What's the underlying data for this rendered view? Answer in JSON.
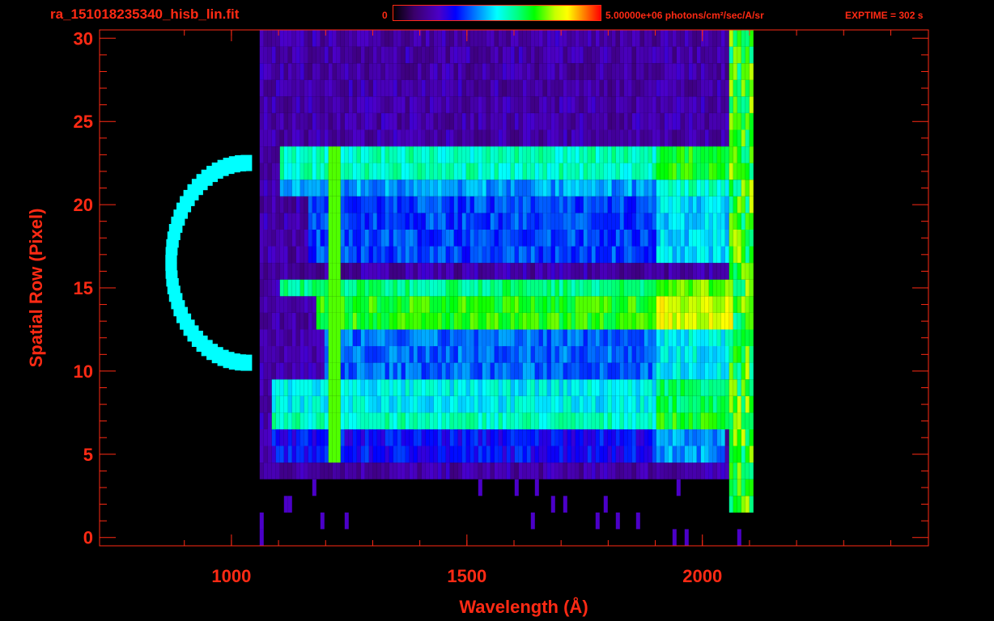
{
  "header": {
    "file_title": "ra_151018235340_hisb_lin.fit",
    "colorbar_min": "0",
    "colorbar_max": "5.00000e+06 photons/cm²/sec/A/sr",
    "exptime": "EXPTIME = 302 s"
  },
  "colors": {
    "foreground": "#ff2a14",
    "background": "#000000"
  },
  "chart_data": {
    "type": "heatmap",
    "xlabel": "Wavelength (Å)",
    "ylabel": "Spatial Row (Pixel)",
    "xlim": [
      720,
      2480
    ],
    "ylim": [
      -0.5,
      30.5
    ],
    "x_ticks": [
      1000,
      1500,
      2000
    ],
    "y_ticks": [
      0,
      5,
      10,
      15,
      20,
      25,
      30
    ],
    "colorbar_range": [
      0,
      5000000
    ],
    "detector_range_angstrom": [
      1060,
      2100
    ],
    "bands": [
      {
        "rows": [
          22,
          23
        ],
        "x_start": 1100,
        "x_end": 2060,
        "level": 0.55
      },
      {
        "rows": [
          21
        ],
        "x_start": 1100,
        "x_end": 2060,
        "level": 0.42
      },
      {
        "rows": [
          17,
          18,
          19,
          20
        ],
        "x_start": 1160,
        "x_end": 2060,
        "level": 0.35
      },
      {
        "rows": [
          15
        ],
        "x_start": 1100,
        "x_end": 2060,
        "level": 0.6
      },
      {
        "rows": [
          14,
          13
        ],
        "x_start": 1180,
        "x_end": 2060,
        "level": 0.68
      },
      {
        "rows": [
          12,
          11,
          10
        ],
        "x_start": 1190,
        "x_end": 2060,
        "level": 0.38
      },
      {
        "rows": [
          9,
          8
        ],
        "x_start": 1080,
        "x_end": 2060,
        "level": 0.5
      },
      {
        "rows": [
          7
        ],
        "x_start": 1080,
        "x_end": 2060,
        "level": 0.55
      },
      {
        "rows": [
          5,
          6
        ],
        "x_start": 1080,
        "x_end": 2040,
        "level": 0.3
      }
    ],
    "emission_line_angstrom": 1216,
    "arc": {
      "center_x": 1030,
      "center_y": 16.5,
      "rx": 160,
      "ry": 6.0
    }
  }
}
